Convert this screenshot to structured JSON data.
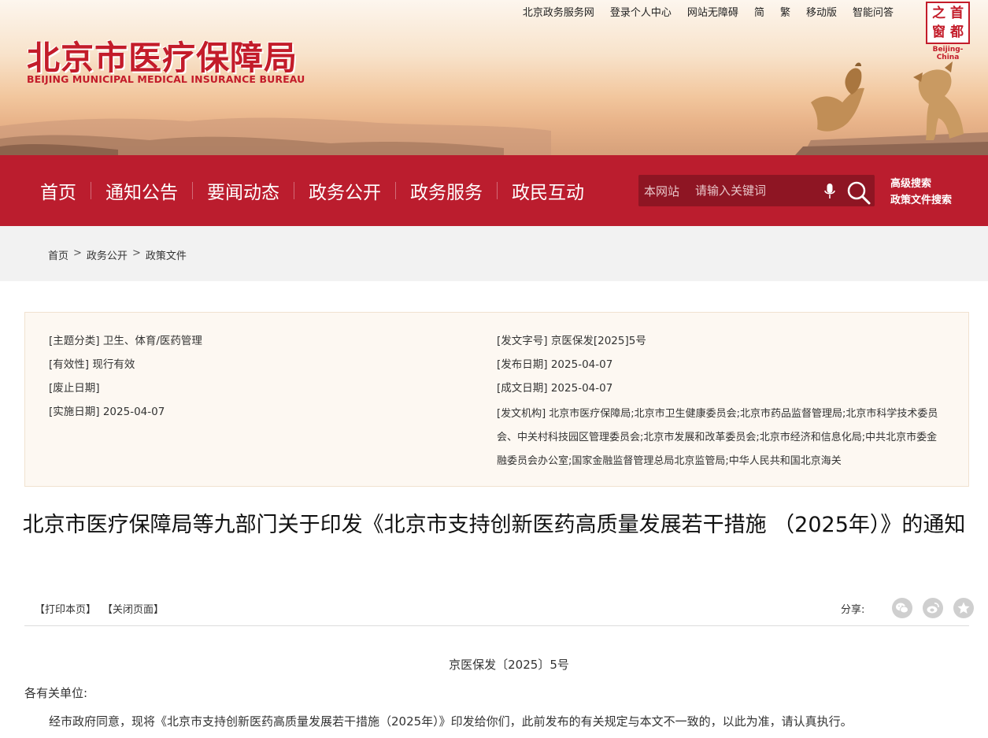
{
  "header": {
    "logo_cn": "北京市医疗保障局",
    "logo_en": "BEIJING MUNICIPAL MEDICAL INSURANCE BUREAU",
    "top_links": [
      "北京政务服务网",
      "登录个人中心",
      "网站无障碍",
      "简",
      "繁",
      "移动版",
      "智能问答"
    ],
    "badge": {
      "chars": [
        "首",
        "都",
        "之",
        "窗"
      ],
      "sub": "Beijing-China"
    }
  },
  "nav": {
    "items": [
      "首页",
      "通知公告",
      "要闻动态",
      "政务公开",
      "政务服务",
      "政民互动"
    ],
    "search_scope": "本网站",
    "search_placeholder": "请输入关键词",
    "advanced_search": "高级搜索",
    "policy_search": "政策文件搜索"
  },
  "breadcrumb": [
    "首页",
    "政务公开",
    "政策文件"
  ],
  "metadata": {
    "topic_label": "[主题分类]",
    "topic": "卫生、体育/医药管理",
    "validity_label": "[有效性]",
    "validity": "现行有效",
    "repeal_label": "[废止日期]",
    "repeal": "",
    "effective_label": "[实施日期]",
    "effective": "2025-04-07",
    "doc_no_label": "[发文字号]",
    "doc_no": "京医保发[2025]5号",
    "publish_label": "[发布日期]",
    "publish": "2025-04-07",
    "written_label": "[成文日期]",
    "written": "2025-04-07",
    "issuer_label": "[发文机构]",
    "issuer": "北京市医疗保障局;北京市卫生健康委员会;北京市药品监督管理局;北京市科学技术委员会、中关村科技园区管理委员会;北京市发展和改革委员会;北京市经济和信息化局;中共北京市委金融委员会办公室;国家金融监督管理总局北京监管局;中华人民共和国北京海关"
  },
  "document": {
    "title": "北京市医疗保障局等九部门关于印发《北京市支持创新医药高质量发展若干措施 （2025年）》的通知",
    "print": "【打印本页】",
    "close": "【关闭页面】",
    "share_label": "分享:",
    "doc_number": "京医保发〔2025〕5号",
    "salutation": "各有关单位:",
    "paragraph1": "经市政府同意，现将《北京市支持创新医药高质量发展若干措施（2025年）》印发给你们，此前发布的有关规定与本文不一致的，以此为准，请认真执行。"
  },
  "colors": {
    "brand_red": "#bb1d2e",
    "search_bg": "#8e1523",
    "meta_bg": "#fdf8f2"
  },
  "icons": [
    "mic-icon",
    "search-icon",
    "wechat-icon",
    "weibo-icon",
    "qzone-icon"
  ]
}
